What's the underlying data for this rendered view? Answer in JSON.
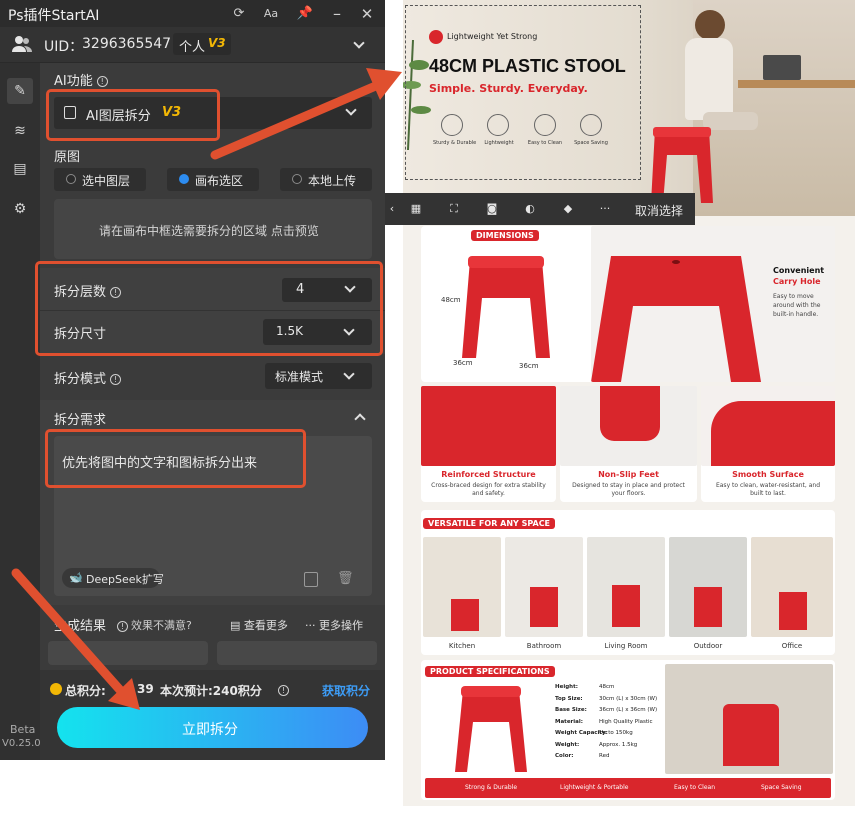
{
  "app": {
    "title": "Ps插件StartAI",
    "font_btn": "Aa"
  },
  "user": {
    "uid_label": "UID：",
    "uid": "3296365547",
    "plan": "个人",
    "version_badge": "V3"
  },
  "ai_function": {
    "label": "AI功能",
    "selected": "AI图层拆分",
    "badge": "V3"
  },
  "source": {
    "label": "原图",
    "options": [
      {
        "label": "选中图层",
        "selected": false
      },
      {
        "label": "画布选区",
        "selected": true
      },
      {
        "label": "本地上传",
        "selected": false
      }
    ],
    "hint": "请在画布中框选需要拆分的区域 点击预览"
  },
  "split_layers": {
    "label": "拆分层数",
    "value": "4"
  },
  "split_size": {
    "label": "拆分尺寸",
    "value": "1.5K"
  },
  "split_mode": {
    "label": "拆分模式",
    "value": "标准模式"
  },
  "split_request": {
    "label": "拆分需求",
    "text": "优先将图中的文字和图标拆分出来",
    "deepseek": "DeepSeek扩写"
  },
  "results": {
    "label": "生成结果",
    "unsatisfied": "效果不满意?",
    "view_more": "查看更多",
    "more_actions": "··· 更多操作"
  },
  "points": {
    "total_label": "总积分:",
    "total_value": "39",
    "estimate": "本次预计:240积分",
    "get_points": "获取积分"
  },
  "action_button": "立即拆分",
  "beta": {
    "label": "Beta",
    "version": "V0.25.0"
  },
  "canvas_toolbar": {
    "cancel": "取消选择"
  },
  "product": {
    "tagline": "Lightweight Yet Strong",
    "title": "48CM PLASTIC STOOL",
    "subtitle": "Simple. Sturdy. Everyday.",
    "hero_features": [
      "Sturdy & Durable",
      "Lightweight",
      "Easy to Clean",
      "Space Saving"
    ],
    "dimensions": {
      "tag": "DIMENSIONS",
      "height": "48cm",
      "width": "36cm",
      "depth": "36cm"
    },
    "carry": {
      "title1": "Convenient",
      "title2": "Carry Hole",
      "desc": "Easy to move around with the built-in handle."
    },
    "features": [
      {
        "title": "Reinforced Structure",
        "desc": "Cross-braced design for extra stability and safety."
      },
      {
        "title": "Non-Slip Feet",
        "desc": "Designed to stay in place and protect your floors."
      },
      {
        "title": "Smooth Surface",
        "desc": "Easy to clean, water-resistant, and built to last."
      }
    ],
    "versatile": {
      "tag": "VERSATILE FOR ANY SPACE",
      "rooms": [
        "Kitchen",
        "Bathroom",
        "Living Room",
        "Outdoor",
        "Office"
      ]
    },
    "specs": {
      "tag": "PRODUCT SPECIFICATIONS",
      "rows": [
        {
          "k": "Height:",
          "v": "48cm"
        },
        {
          "k": "Top Size:",
          "v": "30cm (L) x 30cm (W)"
        },
        {
          "k": "Base Size:",
          "v": "36cm (L) x 36cm (W)"
        },
        {
          "k": "Material:",
          "v": "High Quality Plastic"
        },
        {
          "k": "Weight Capacity:",
          "v": "Up to 150kg"
        },
        {
          "k": "Weight:",
          "v": "Approx. 1.5kg"
        },
        {
          "k": "Color:",
          "v": "Red"
        }
      ]
    },
    "footer": [
      "Strong & Durable",
      "Lightweight & Portable",
      "Easy to Clean",
      "Space Saving"
    ]
  },
  "colors": {
    "accent": "#e0502f",
    "product_red": "#d9262c",
    "badge": "#f2b705",
    "button_from": "#14e3ee",
    "button_to": "#3d8cf5"
  }
}
